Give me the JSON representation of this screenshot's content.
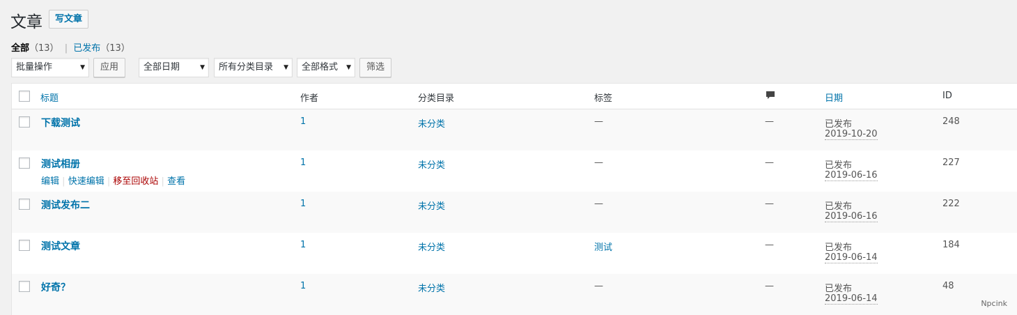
{
  "header": {
    "title": "文章",
    "add_new": "写文章"
  },
  "views": {
    "all_label": "全部",
    "all_count": "（13）",
    "separator": "|",
    "published_label": "已发布",
    "published_count": "（13）"
  },
  "filters": {
    "bulk_action": "批量操作",
    "apply": "应用",
    "date": "全部日期",
    "category": "所有分类目录",
    "format": "全部格式",
    "filter_button": "筛选"
  },
  "columns": {
    "title": "标题",
    "author": "作者",
    "categories": "分类目录",
    "tags": "标签",
    "comments_icon": "comment-bubble-icon",
    "date": "日期",
    "id": "ID"
  },
  "row_actions": {
    "edit": "编辑",
    "quick_edit": "快速编辑",
    "trash": "移至回收站",
    "view": "查看",
    "sep": "|"
  },
  "posts": [
    {
      "title": "下载测试",
      "author": "1",
      "category": "未分类",
      "tags": "—",
      "comments": "—",
      "status": "已发布",
      "date": "2019-10-20",
      "id": "248"
    },
    {
      "title": "测试相册",
      "author": "1",
      "category": "未分类",
      "tags": "—",
      "comments": "—",
      "status": "已发布",
      "date": "2019-06-16",
      "id": "227"
    },
    {
      "title": "测试发布二",
      "author": "1",
      "category": "未分类",
      "tags": "—",
      "comments": "—",
      "status": "已发布",
      "date": "2019-06-16",
      "id": "222"
    },
    {
      "title": "测试文章",
      "author": "1",
      "category": "未分类",
      "tags": "测试",
      "comments": "—",
      "status": "已发布",
      "date": "2019-06-14",
      "id": "184"
    },
    {
      "title": "好奇？",
      "author": "1",
      "category": "未分类",
      "tags": "—",
      "comments": "—",
      "status": "已发布",
      "date": "2019-06-14",
      "id": "48"
    }
  ],
  "watermark": "Npcink",
  "colors": {
    "link": "#0073aa",
    "trash": "#a00",
    "background": "#f1f1f1"
  }
}
